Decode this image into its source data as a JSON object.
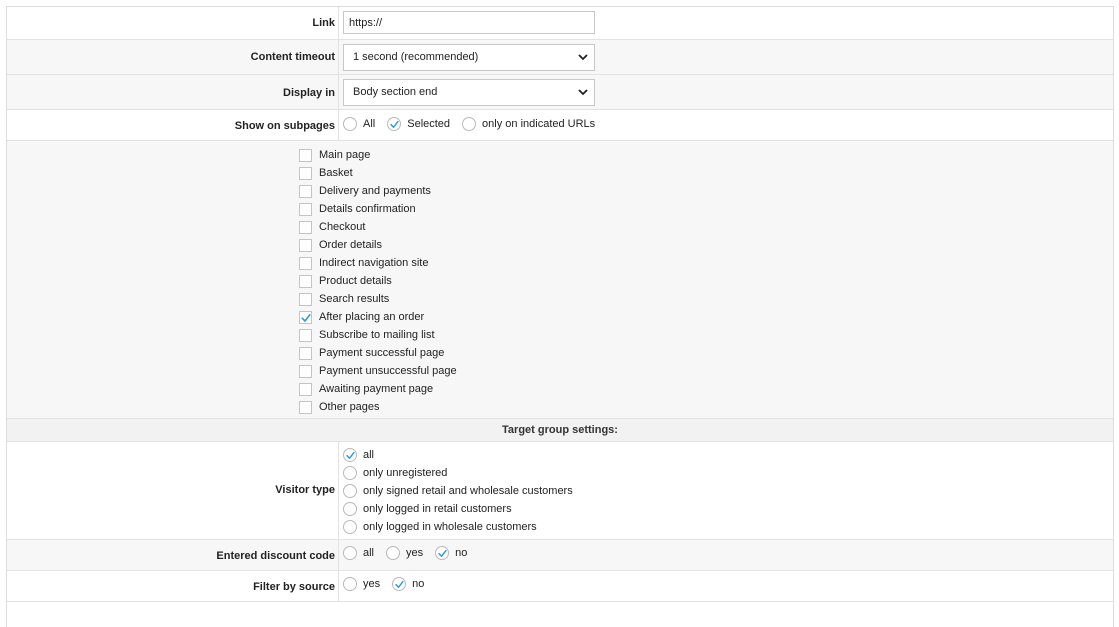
{
  "link": {
    "label": "Link",
    "value": "https://"
  },
  "content_timeout": {
    "label": "Content timeout",
    "selected": "1 second (recommended)"
  },
  "display_in": {
    "label": "Display in",
    "selected": "Body section end"
  },
  "show_on_subpages": {
    "label": "Show on subpages",
    "options": [
      {
        "label": "All",
        "checked": false
      },
      {
        "label": "Selected",
        "checked": true
      },
      {
        "label": "only on indicated URLs",
        "checked": false
      }
    ]
  },
  "subpages": [
    {
      "label": "Main page",
      "checked": false
    },
    {
      "label": "Basket",
      "checked": false
    },
    {
      "label": "Delivery and payments",
      "checked": false
    },
    {
      "label": "Details confirmation",
      "checked": false
    },
    {
      "label": "Checkout",
      "checked": false
    },
    {
      "label": "Order details",
      "checked": false
    },
    {
      "label": "Indirect navigation site",
      "checked": false
    },
    {
      "label": "Product details",
      "checked": false
    },
    {
      "label": "Search results",
      "checked": false
    },
    {
      "label": "After placing an order",
      "checked": true
    },
    {
      "label": "Subscribe to mailing list",
      "checked": false
    },
    {
      "label": "Payment successful page",
      "checked": false
    },
    {
      "label": "Payment unsuccessful page",
      "checked": false
    },
    {
      "label": "Awaiting payment page",
      "checked": false
    },
    {
      "label": "Other pages",
      "checked": false
    }
  ],
  "target_group": {
    "heading": "Target group settings:"
  },
  "visitor_type": {
    "label": "Visitor type",
    "options": [
      {
        "label": "all",
        "checked": true
      },
      {
        "label": "only unregistered",
        "checked": false
      },
      {
        "label": "only signed retail and wholesale customers",
        "checked": false
      },
      {
        "label": "only logged in retail customers",
        "checked": false
      },
      {
        "label": "only logged in wholesale customers",
        "checked": false
      }
    ]
  },
  "discount_code": {
    "label": "Entered discount code",
    "options": [
      {
        "label": "all",
        "checked": false
      },
      {
        "label": "yes",
        "checked": false
      },
      {
        "label": "no",
        "checked": true
      }
    ]
  },
  "filter_source": {
    "label": "Filter by source",
    "options": [
      {
        "label": "yes",
        "checked": false
      },
      {
        "label": "no",
        "checked": true
      }
    ]
  },
  "colors": {
    "check": "#2a9bd6",
    "border": "#e2e2e2",
    "label": "#222222"
  }
}
